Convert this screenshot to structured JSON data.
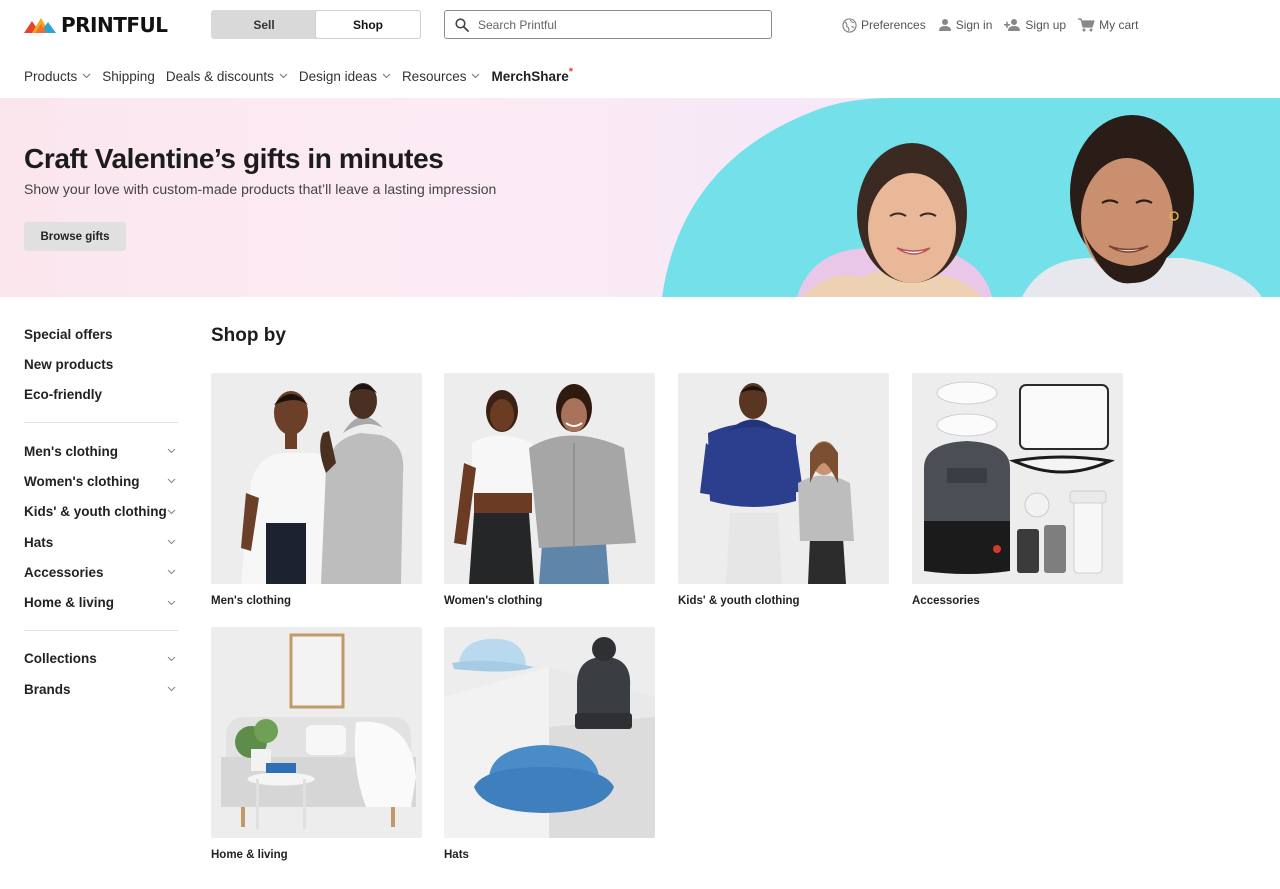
{
  "brand": {
    "name": "PRINTFUL"
  },
  "header": {
    "modes": [
      {
        "label": "Sell",
        "active": false
      },
      {
        "label": "Shop",
        "active": true
      }
    ],
    "search": {
      "placeholder": "Search Printful",
      "value": ""
    },
    "utilities": [
      {
        "label": "Preferences",
        "icon": "globe-icon"
      },
      {
        "label": "Sign in",
        "icon": "user-icon"
      },
      {
        "label": "Sign up",
        "icon": "user-plus-icon"
      },
      {
        "label": "My cart",
        "icon": "cart-icon"
      }
    ]
  },
  "nav": {
    "items": [
      {
        "label": "Products",
        "dropdown": true
      },
      {
        "label": "Shipping",
        "dropdown": false
      },
      {
        "label": "Deals & discounts",
        "dropdown": true
      },
      {
        "label": "Design ideas",
        "dropdown": true
      },
      {
        "label": "Resources",
        "dropdown": true
      }
    ],
    "merchshare": {
      "label": "MerchShare",
      "mark": "*"
    }
  },
  "hero": {
    "title": "Craft Valentine’s gifts in minutes",
    "subtitle": "Show your love with custom-made products that’ll leave a lasting impression",
    "button_label": "Browse gifts"
  },
  "sidebar": {
    "links": [
      "Special offers",
      "New products",
      "Eco-friendly"
    ],
    "categories": [
      "Men's clothing",
      "Women's clothing",
      "Kids' & youth clothing",
      "Hats",
      "Accessories",
      "Home & living"
    ],
    "more": [
      "Collections",
      "Brands"
    ]
  },
  "shop": {
    "title": "Shop by",
    "tiles": [
      {
        "label": "Men's clothing"
      },
      {
        "label": "Women's clothing"
      },
      {
        "label": "Kids' & youth clothing"
      },
      {
        "label": "Accessories"
      },
      {
        "label": "Home & living"
      },
      {
        "label": "Hats"
      }
    ]
  },
  "colors": {
    "accent_red": "#e8412c",
    "hero_teal": "#74e1ea",
    "hero_pink": "#fbe6ee",
    "tile_bg": "#ededed"
  }
}
